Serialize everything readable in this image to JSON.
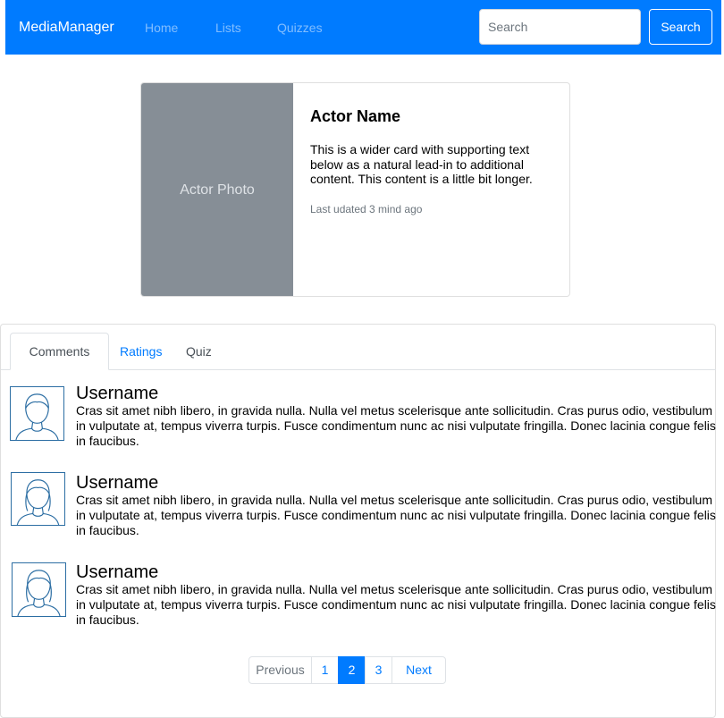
{
  "navbar": {
    "brand": "MediaManager",
    "links": [
      "Home",
      "Lists",
      "Quizzes"
    ],
    "search_placeholder": "Search",
    "search_button": "Search"
  },
  "actor_card": {
    "photo_label": "Actor Photo",
    "title": "Actor Name",
    "text": "This is a wider card with supporting text below as a natural lead-in to additional content. This content is a little bit longer.",
    "updated": "Last udated 3 mind ago"
  },
  "tabs": {
    "items": [
      "Comments",
      "Ratings",
      "Quiz"
    ],
    "active": "Comments"
  },
  "comments": [
    {
      "username": "Username",
      "text": "Cras sit amet nibh libero, in gravida nulla. Nulla vel metus scelerisque ante sollicitudin. Cras purus odio, vestibulum in vulputate at, tempus viverra turpis. Fusce condimentum nunc ac nisi vulputate fringilla. Donec lacinia congue felis in faucibus.",
      "avatar_icon": "user-avatar-icon"
    },
    {
      "username": "Username",
      "text": "Cras sit amet nibh libero, in gravida nulla. Nulla vel metus scelerisque ante sollicitudin. Cras purus odio, vestibulum in vulputate at, tempus viverra turpis. Fusce condimentum nunc ac nisi vulputate fringilla. Donec lacinia congue felis in faucibus.",
      "avatar_icon": "user-avatar-icon"
    },
    {
      "username": "Username",
      "text": "Cras sit amet nibh libero, in gravida nulla. Nulla vel metus scelerisque ante sollicitudin. Cras purus odio, vestibulum in vulputate at, tempus viverra turpis. Fusce condimentum nunc ac nisi vulputate fringilla. Donec lacinia congue felis in faucibus.",
      "avatar_icon": "user-avatar-icon"
    }
  ],
  "pagination": {
    "previous": "Previous",
    "pages": [
      "1",
      "2",
      "3"
    ],
    "active_page": "2",
    "next": "Next"
  },
  "colors": {
    "primary": "#007bff",
    "photo_bg": "#868e96",
    "avatar_stroke": "#2c6ea3"
  }
}
